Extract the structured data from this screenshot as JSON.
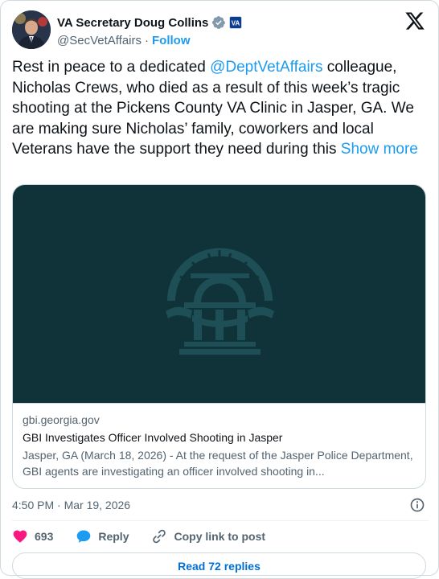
{
  "author": {
    "display_name": "VA Secretary Doug Collins",
    "handle": "@SecVetAffairs",
    "separator": "·",
    "follow_label": "Follow",
    "badge_text": "VA"
  },
  "tweet": {
    "text_before": "Rest in peace to a dedicated ",
    "mention": "@DeptVetAffairs",
    "text_after": " colleague, Nicholas Crews, who died as a result of this week’s tragic shooting at the Pickens County VA Clinic in Jasper, GA. We are making sure Nicholas’ family, coworkers and local Veterans have the support they need during this ",
    "show_more": "Show more"
  },
  "link_card": {
    "domain": "gbi.georgia.gov",
    "title": "GBI Investigates Officer Involved Shooting in Jasper",
    "description": "Jasper, GA (March 18, 2026) - At the request of the Jasper Police Department, GBI agents are investigating an officer involved shooting in..."
  },
  "timestamp": "4:50 PM · Mar 19, 2026",
  "actions": {
    "like_count": "693",
    "reply_label": "Reply",
    "copy_link_label": "Copy link to post"
  },
  "read_replies_label": "Read 72 replies",
  "colors": {
    "accent": "#1d9bf0",
    "like": "#f91880",
    "card_image_bg": "#0f3339",
    "seal": "#1f4f56"
  },
  "icons": [
    "verified-badge-icon",
    "va-badge-icon",
    "x-logo-icon",
    "georgia-seal-icon",
    "info-icon",
    "heart-icon",
    "reply-icon",
    "link-icon"
  ]
}
